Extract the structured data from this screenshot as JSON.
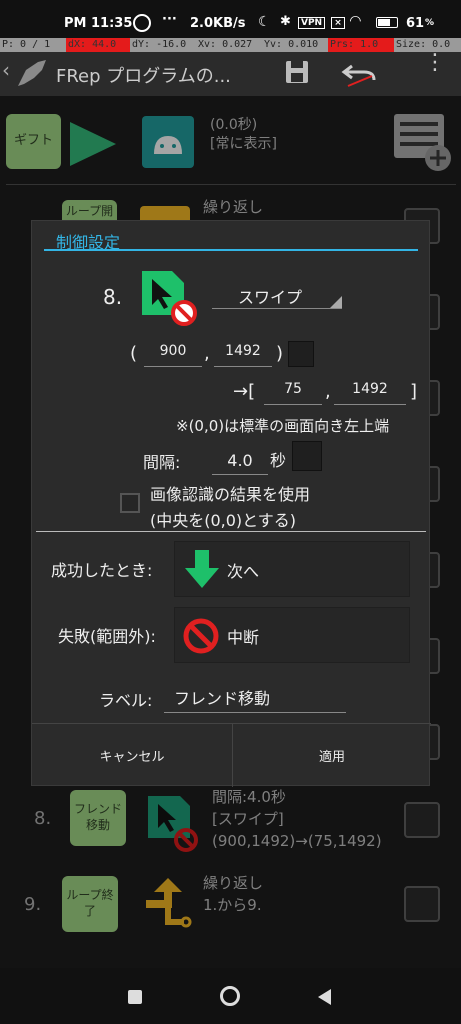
{
  "status": {
    "time": "PM 11:35",
    "dots": "···",
    "speed": "2.0KB/s",
    "vpn": "VPN",
    "battery": "61",
    "battery_unit": "%"
  },
  "pointer": {
    "p": "P: 0 / 1",
    "dx": "dX: 44.0",
    "dy": "dY: -16.0",
    "xv": "Xv: 0.027",
    "yv": "Yv: 0.010",
    "prs": "Prs: 1.0",
    "size": "Size: 0.0"
  },
  "appbar": {
    "title": "FRep プログラムの..."
  },
  "header": {
    "gift": "ギフト",
    "time": "(0.0秒)",
    "always": "[常に表示]"
  },
  "list": {
    "row1": {
      "button": "ループ開始",
      "text": "繰り返し"
    },
    "row8": {
      "number": "8.",
      "button": "フレンド移動",
      "line1": "間隔:4.0秒",
      "line2": "[スワイプ]",
      "line3": "(900,1492)→(75,1492)"
    },
    "row9": {
      "number": "9.",
      "button": "ループ終了",
      "line1": "繰り返し",
      "line2": "1.から9."
    }
  },
  "dialog": {
    "title": "制御設定",
    "step_number": "8.",
    "action": "スワイプ",
    "start": {
      "open": "(",
      "x": "900",
      "comma": ",",
      "y": "1492",
      "close": ")"
    },
    "end": {
      "arrow": "→[",
      "x": "75",
      "comma": ",",
      "y": "1492",
      "close": "]"
    },
    "note": "※(0,0)は標準の画面向き左上端",
    "interval_label": "間隔:",
    "interval_value": "4.0",
    "interval_unit": "秒",
    "image_recog_line1": "画像認識の結果を使用",
    "image_recog_line2": "(中央を(0,0)とする)",
    "success_label": "成功したとき:",
    "success_value": "次へ",
    "fail_label": "失敗(範囲外):",
    "fail_value": "中断",
    "label_label": "ラベル:",
    "label_value": "フレンド移動",
    "cancel": "キャンセル",
    "apply": "適用"
  },
  "colors": {
    "accent": "#33b5e5",
    "green": "#1ec06a",
    "red": "#e02020"
  }
}
